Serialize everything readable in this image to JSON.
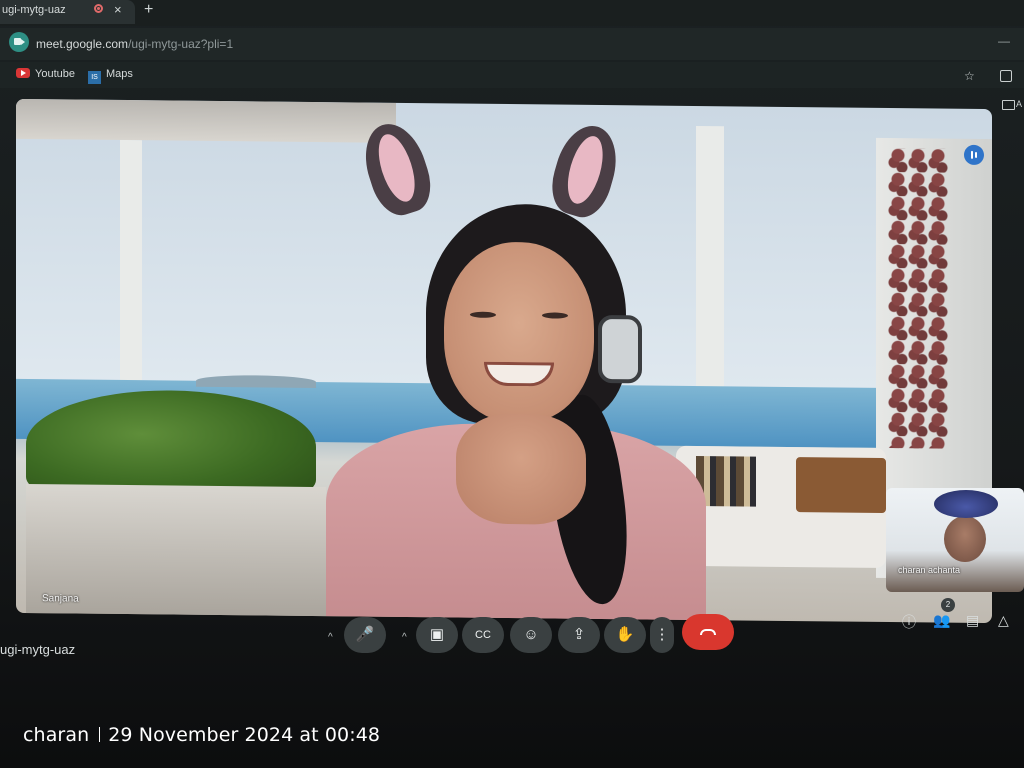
{
  "browser": {
    "tab_title": "ugi-mytg-uaz",
    "tab_close": "×",
    "new_tab": "+",
    "url_host": "meet.google.com",
    "url_path": "/ugi-mytg-uaz?pli=1",
    "bookmarks": [
      {
        "label": "Youtube",
        "icon": "youtube-icon"
      },
      {
        "label": "Maps",
        "icon": "maps-icon",
        "icon_text": "IS"
      }
    ],
    "star": "☆",
    "minimize": "—",
    "all_bookmarks_label": "A"
  },
  "meet": {
    "main_participant": "Sanjana",
    "self_participant": "charan achanta",
    "meeting_code": "ugi-mytg-uaz",
    "participant_count": "2",
    "controls": {
      "caret": "^",
      "mic": "🎤",
      "camera": "▣",
      "captions": "CC",
      "reactions": "☺",
      "present": "⇪",
      "raise_hand": "✋",
      "more": "⋮",
      "info": "ⓘ",
      "people": "👥",
      "chat": "▤",
      "activities": "△"
    },
    "colors": {
      "end_call": "#d9372e",
      "speaking_indicator": "#2f74c9"
    }
  },
  "photo_caption": {
    "author": "charan",
    "datetime": "29 November 2024 at 00:48"
  }
}
